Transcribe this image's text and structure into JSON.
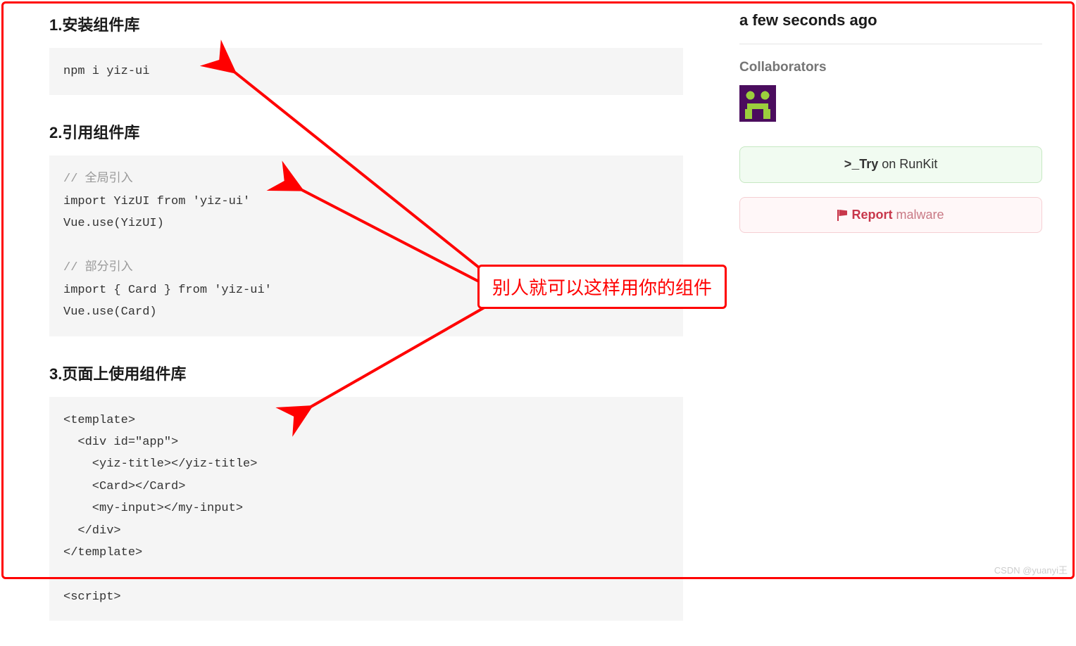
{
  "sections": [
    {
      "heading": "1.安装组件库",
      "code": "npm i yiz-ui"
    },
    {
      "heading": "2.引用组件库",
      "code": "// 全局引入\nimport YizUI from 'yiz-ui'\nVue.use(YizUI)\n\n// 部分引入\nimport { Card } from 'yiz-ui'\nVue.use(Card)"
    },
    {
      "heading": "3.页面上使用组件库",
      "code": "<template>\n  <div id=\"app\">\n    <yiz-title></yiz-title>\n    <Card></Card>\n    <my-input></my-input>\n  </div>\n</template>\n\n<script>"
    }
  ],
  "sidebar": {
    "published_time": "a few seconds ago",
    "collaborators_label": "Collaborators",
    "try_prefix": "Try",
    "try_suffix": " on RunKit",
    "report_bold": "Report",
    "report_light": " malware"
  },
  "annotation": {
    "text": "别人就可以这样用你的组件"
  },
  "watermark": "CSDN @yuanyi王"
}
